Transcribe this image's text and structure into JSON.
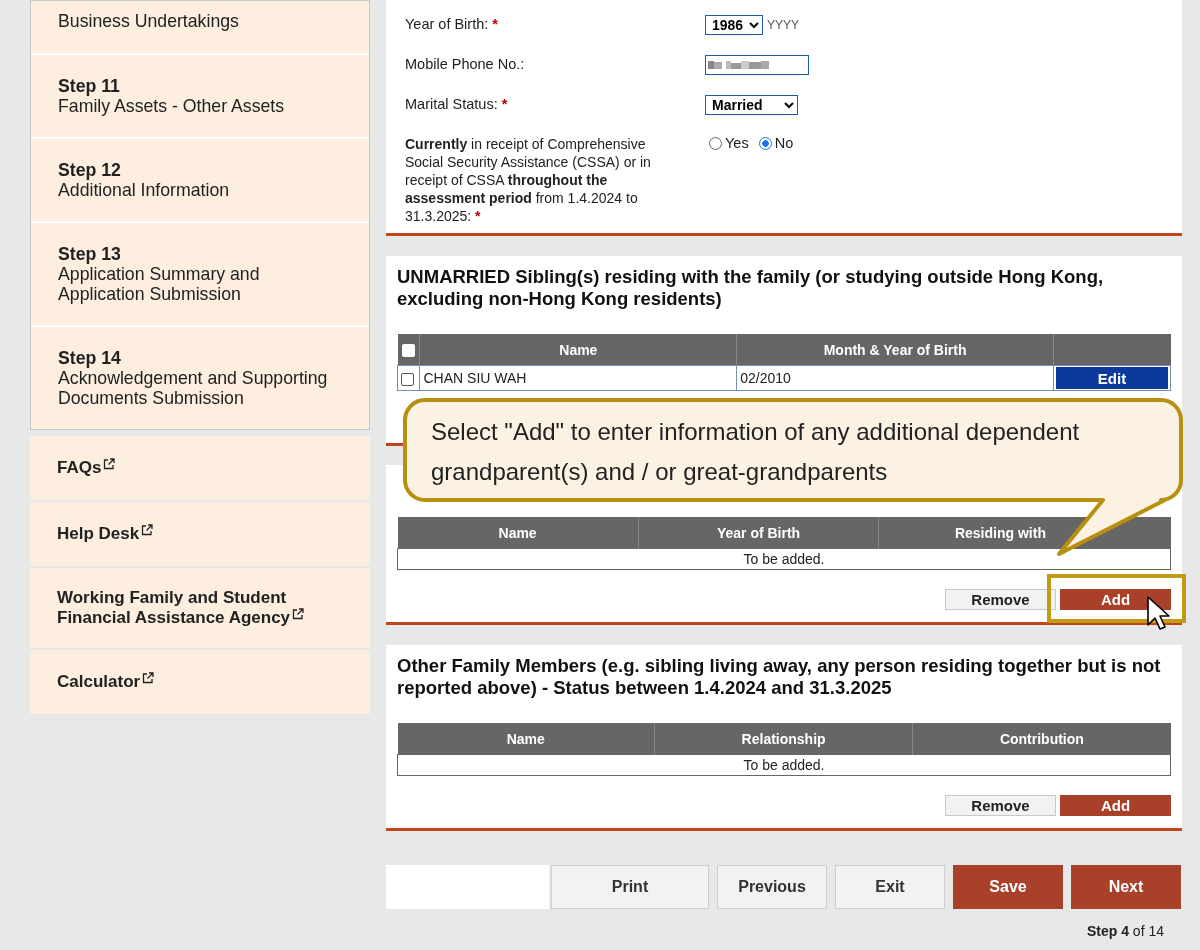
{
  "sidebar": {
    "steps": [
      {
        "title": "Business Undertakings"
      },
      {
        "step": "Step 11",
        "title": "Family Assets - Other Assets"
      },
      {
        "step": "Step 12",
        "title": "Additional Information"
      },
      {
        "step": "Step 13",
        "title": "Application Summary and Application Submission"
      },
      {
        "step": "Step 14",
        "title": "Acknowledgement and Supporting Documents Submission"
      }
    ],
    "links": [
      {
        "label": "FAQs"
      },
      {
        "label": "Help Desk"
      },
      {
        "label": "Working Family and Student Financial Assistance Agency"
      },
      {
        "label": "Calculator"
      }
    ]
  },
  "form": {
    "fields": [
      {
        "kind": "select",
        "label": "Year of Birth:",
        "required_mark": "*",
        "value": "1986",
        "hint": "YYYY"
      },
      {
        "kind": "masked",
        "label": "Mobile Phone No.:"
      },
      {
        "kind": "select",
        "label": "Marital Status:",
        "required_mark": "*",
        "value": "Married"
      },
      {
        "kind": "radio",
        "label": "**Currently** in receipt of Comprehensive Social Security Assistance (CSSA) or in receipt of CSSA **throughout the assessment period** from 1.4.2024 to 31.3.2025:",
        "required_mark": "*",
        "options": [
          {
            "label": "Yes",
            "selected": false
          },
          {
            "label": "No",
            "selected": true
          }
        ]
      }
    ]
  },
  "sections": [
    {
      "heading": "UNMARRIED Sibling(s) residing with the family (or studying outside Hong Kong, excluding non-Hong Kong residents)",
      "table": {
        "select_all_checked": false,
        "columns": [
          "Name",
          "Month & Year of Birth"
        ],
        "rows": [
          {
            "checked": false,
            "cells": [
              "CHAN SIU WAH",
              "02/2010"
            ],
            "action": "Edit"
          }
        ]
      }
    },
    {
      "table": {
        "columns": [
          "Name",
          "Year of Birth",
          "Residing with"
        ],
        "empty": "To be added."
      },
      "buttons": [
        {
          "label": "Remove",
          "kind": "secondary",
          "highlighted": false
        },
        {
          "label": "Add",
          "kind": "primary",
          "highlighted": true
        }
      ]
    },
    {
      "heading": "Other Family Members (e.g. sibling living away, any person residing together but is not reported above) - Status between 1.4.2024 and 31.3.2025",
      "table": {
        "columns": [
          "Name",
          "Relationship",
          "Contribution"
        ],
        "empty": "To be added."
      },
      "buttons": [
        {
          "label": "Remove",
          "kind": "secondary",
          "highlighted": false
        },
        {
          "label": "Add",
          "kind": "primary",
          "highlighted": false
        }
      ]
    }
  ],
  "callout": {
    "text": "Select \"Add\" to enter information of any additional dependent grandparent(s) and / or great-grandparents"
  },
  "nav_buttons": [
    {
      "label": "Print",
      "kind": "secondary"
    },
    {
      "label": "Previous",
      "kind": "secondary"
    },
    {
      "label": "Exit",
      "kind": "secondary"
    },
    {
      "label": "Save",
      "kind": "primary"
    },
    {
      "label": "Next",
      "kind": "primary"
    }
  ],
  "progress": {
    "current": "Step 4",
    "total": "of 14"
  }
}
